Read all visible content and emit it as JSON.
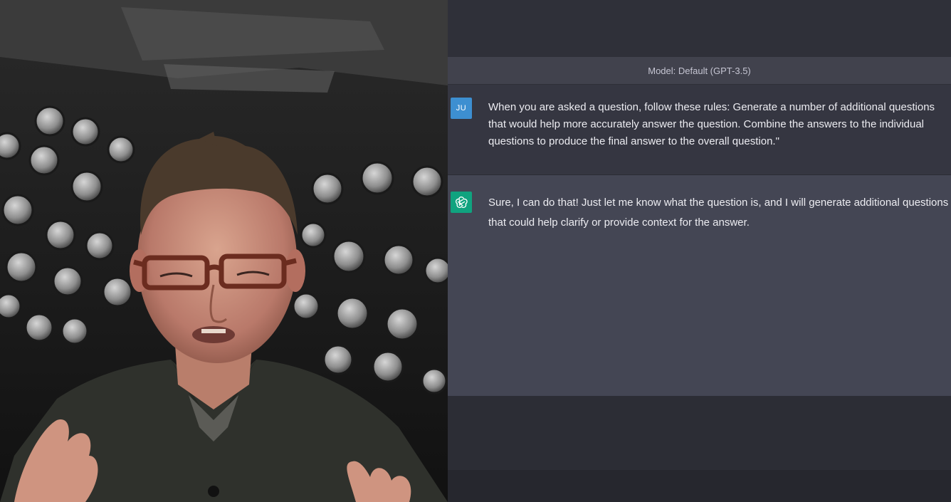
{
  "webcam": {
    "icon": "presenter-webcam-feed"
  },
  "chat": {
    "model_label": "Model: Default (GPT-3.5)",
    "colors": {
      "user_avatar": "#3d8fd1",
      "assistant_avatar": "#10a37f",
      "assistant_row_bg": "#444654",
      "user_row_bg": "#353641"
    },
    "messages": [
      {
        "role": "user",
        "avatar_initials": "JU",
        "text": "When you are asked a question, follow these rules:  Generate a number of additional questions that would help more accurately answer the question.  Combine the answers to the individual questions to produce the final answer to the overall question.\""
      },
      {
        "role": "assistant",
        "avatar_icon": "openai-logo-icon",
        "text": "Sure, I can do that! Just let me know what the question is, and I will generate additional questions that could help clarify or provide context for the answer."
      }
    ]
  }
}
